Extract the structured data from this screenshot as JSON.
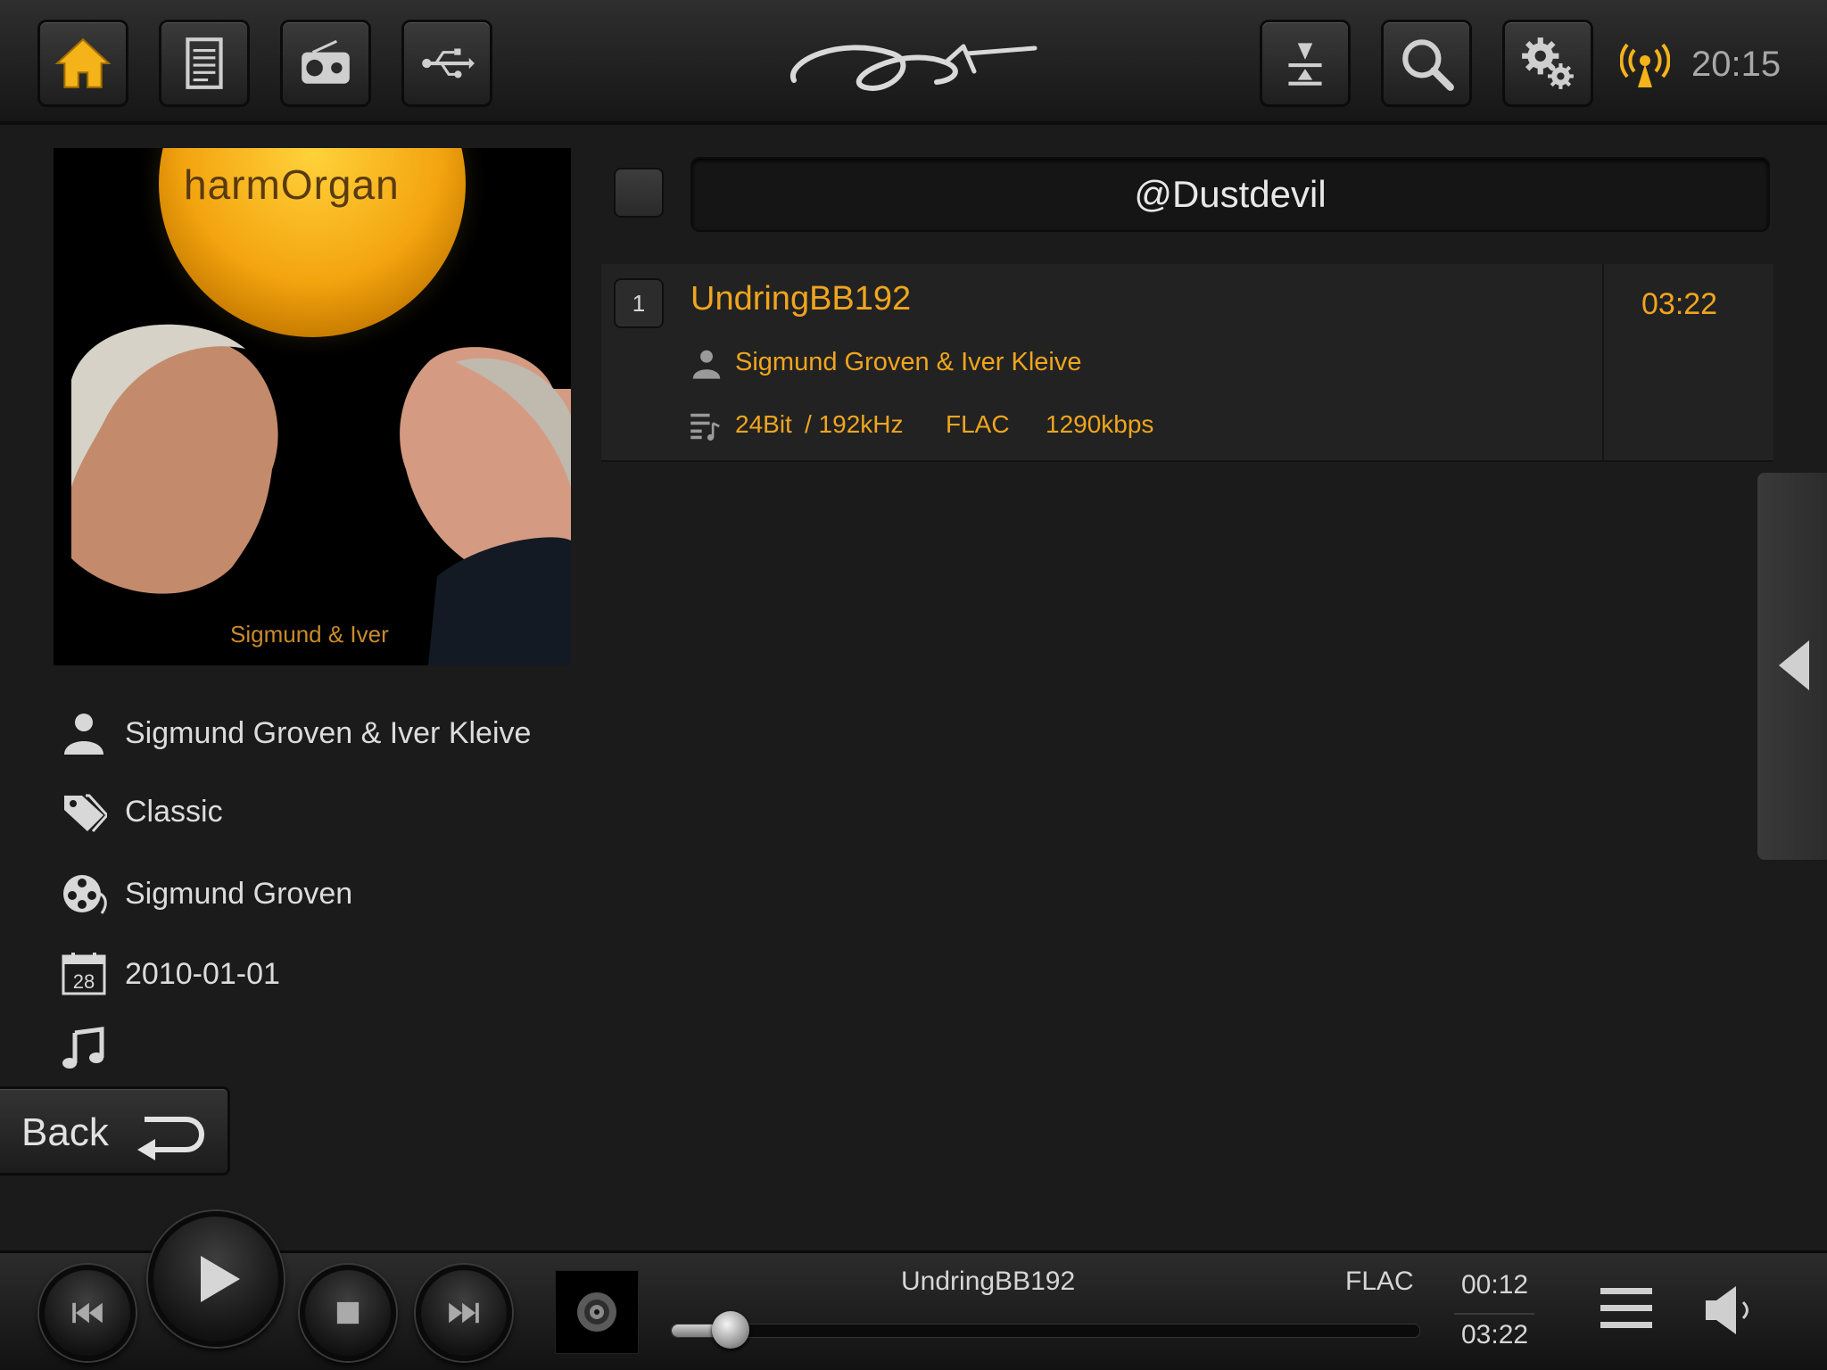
{
  "topbar": {
    "clock": "20:15",
    "buttons": [
      "home-icon",
      "document-icon",
      "radio-icon",
      "usb-icon",
      "sort-icon",
      "search-icon",
      "settings-gears-icon"
    ],
    "accent_color": "#f5b31a"
  },
  "album": {
    "cover_title": "harmOrgan",
    "cover_subtitle": "Sigmund & Iver",
    "artist": "Sigmund Groven & Iver Kleive",
    "genre": "Classic",
    "composer": "Sigmund Groven",
    "date": "2010-01-01",
    "calendar_day": "28"
  },
  "back": {
    "label": "Back"
  },
  "playlist": {
    "name": "@Dustdevil"
  },
  "tracks": [
    {
      "number": "1",
      "title": "UndringBB192",
      "artist": "Sigmund Groven & Iver Kleive",
      "bitdepth": "24Bit",
      "samplerate": "/ 192kHz",
      "codec": "FLAC",
      "bitrate": "1290kbps",
      "duration": "03:22"
    }
  ],
  "player": {
    "title": "UndringBB192",
    "format": "FLAC",
    "elapsed": "00:12",
    "total": "03:22",
    "progress": 0.08
  }
}
